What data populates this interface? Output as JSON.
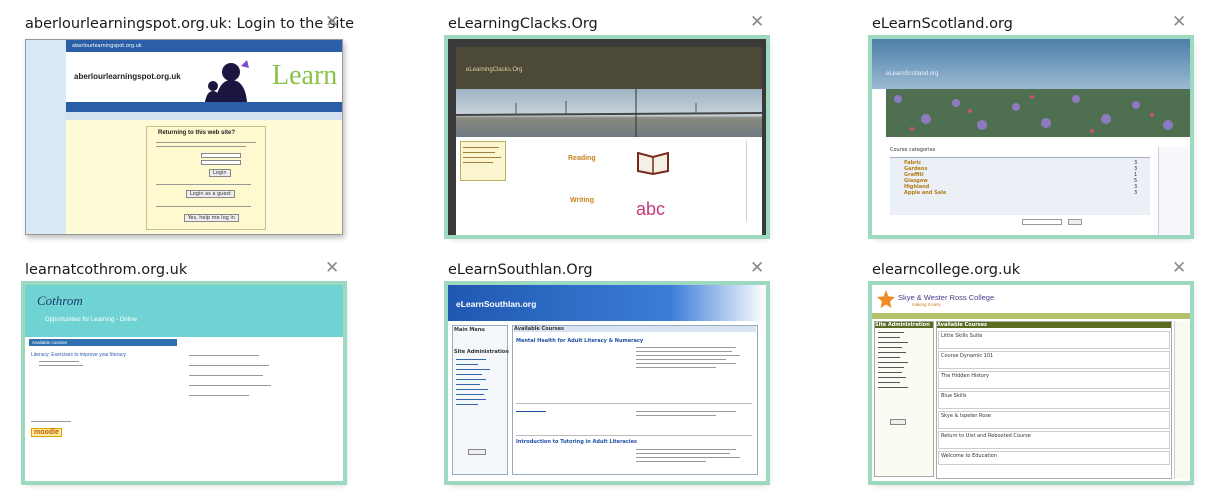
{
  "tiles": [
    {
      "title": "aberlourlearningspot.org.uk: Login to the site",
      "close": "✕",
      "preview": {
        "url_bar": "aberlourlearningspot.org.uk",
        "site_name": "aberlourlearningspot.org.uk",
        "logo_text": "Learn",
        "heading": "Returning to this web site?",
        "login_button": "Login",
        "guest_button": "Login as a guest",
        "password_button": "Yes, help me log in"
      }
    },
    {
      "title": "eLearningClacks.Org",
      "close": "✕",
      "preview": {
        "site_name": "eLearningClacks.Org",
        "reading": "Reading",
        "writing": "Writing",
        "abc": "abc"
      }
    },
    {
      "title": "eLearnScotland.org",
      "close": "✕",
      "preview": {
        "site_name": "eLearnScotland.org",
        "category_heading": "Course categories",
        "categories": [
          "Fabric",
          "Gardens",
          "Graffiti",
          "Glasgow",
          "Highland",
          "Apple and Sale"
        ],
        "counts": [
          "3",
          "3",
          "1",
          "5",
          "3",
          "3"
        ]
      }
    },
    {
      "title": "learnatcothrom.org.uk",
      "close": "✕",
      "preview": {
        "site_name": "Cothrom",
        "tagline": "Opportunities for Learning - Online",
        "section": "Available courses",
        "course": "Literacy: Exercises to improve your literacy",
        "moodle": "moodle"
      }
    },
    {
      "title": "eLearnSouthlan.Org",
      "close": "✕",
      "preview": {
        "site_name": "eLearnSouthlan.org",
        "left_heading": "Main Menu",
        "admin_heading": "Site Administration",
        "courses_heading": "Available Courses",
        "course_1": "Mental Health for Adult Literacy & Numeracy",
        "course_2": "Introduction to Tutoring in Adult Literacies"
      }
    },
    {
      "title": "elearncollege.org.uk",
      "close": "✕",
      "preview": {
        "site_name": "Skye & Wester Ross College",
        "site_sub": "making it easy",
        "left_heading": "Site Administration",
        "courses_heading": "Available Courses",
        "courses": [
          "Little Skills Suite",
          "Course Dynamic 101",
          "The Hidden History",
          "Blue Skills",
          "Skye & Ispeter Rose",
          "Return to Uist and Rebooted Course",
          "Welcome to Education"
        ]
      }
    }
  ]
}
